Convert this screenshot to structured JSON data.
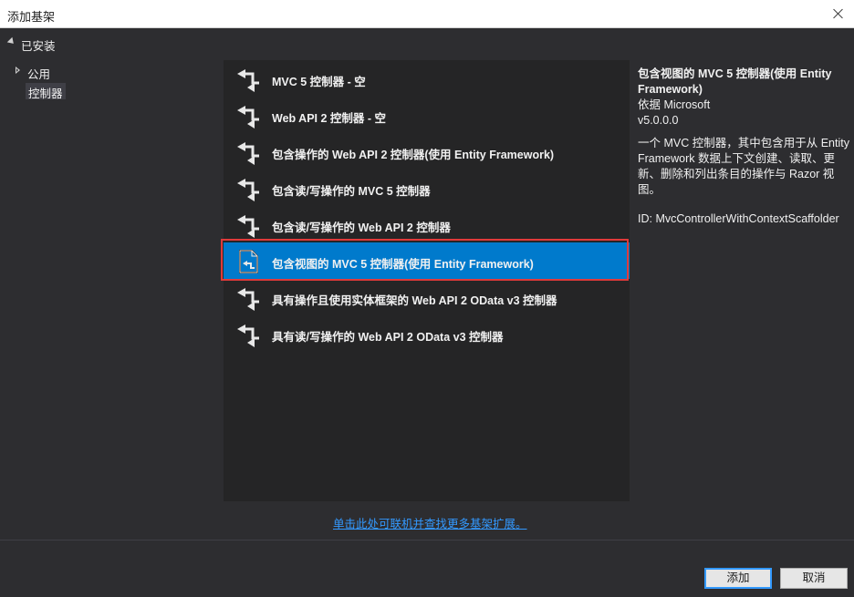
{
  "dialog": {
    "title": "添加基架"
  },
  "tree": {
    "root_label": "已安装",
    "items": [
      {
        "label": "公用"
      },
      {
        "label": "控制器"
      }
    ]
  },
  "list": {
    "items": [
      {
        "label": "MVC 5 控制器 - 空",
        "icon": "scaffold-icon"
      },
      {
        "label": "Web API 2 控制器 - 空",
        "icon": "scaffold-icon"
      },
      {
        "label": "包含操作的 Web API 2 控制器(使用 Entity Framework)",
        "icon": "scaffold-icon"
      },
      {
        "label": "包含读/写操作的 MVC 5 控制器",
        "icon": "scaffold-icon"
      },
      {
        "label": "包含读/写操作的 Web API 2 控制器",
        "icon": "scaffold-icon"
      },
      {
        "label": "包含视图的 MVC 5 控制器(使用 Entity Framework)",
        "icon": "document-scaffold-icon",
        "selected": true
      },
      {
        "label": "具有操作且使用实体框架的 Web API 2 OData v3 控制器",
        "icon": "scaffold-icon"
      },
      {
        "label": "具有读/写操作的 Web API 2 OData v3 控制器",
        "icon": "scaffold-icon"
      }
    ]
  },
  "details": {
    "title": "包含视图的 MVC 5 控制器(使用 Entity Framework)",
    "author": "依据 Microsoft",
    "version": "v5.0.0.0",
    "description": "一个 MVC 控制器，其中包含用于从 Entity Framework 数据上下文创建、读取、更新、删除和列出条目的操作与 Razor 视图。",
    "id": "ID: MvcControllerWithContextScaffolder"
  },
  "online_link": "单击此处可联机并查找更多基架扩展。",
  "buttons": {
    "add": "添加",
    "cancel": "取消"
  },
  "colors": {
    "background": "#2d2d30",
    "list_background": "#252526",
    "selection": "#007acc",
    "highlight_outline": "#e03a3a",
    "link": "#3399ff"
  }
}
